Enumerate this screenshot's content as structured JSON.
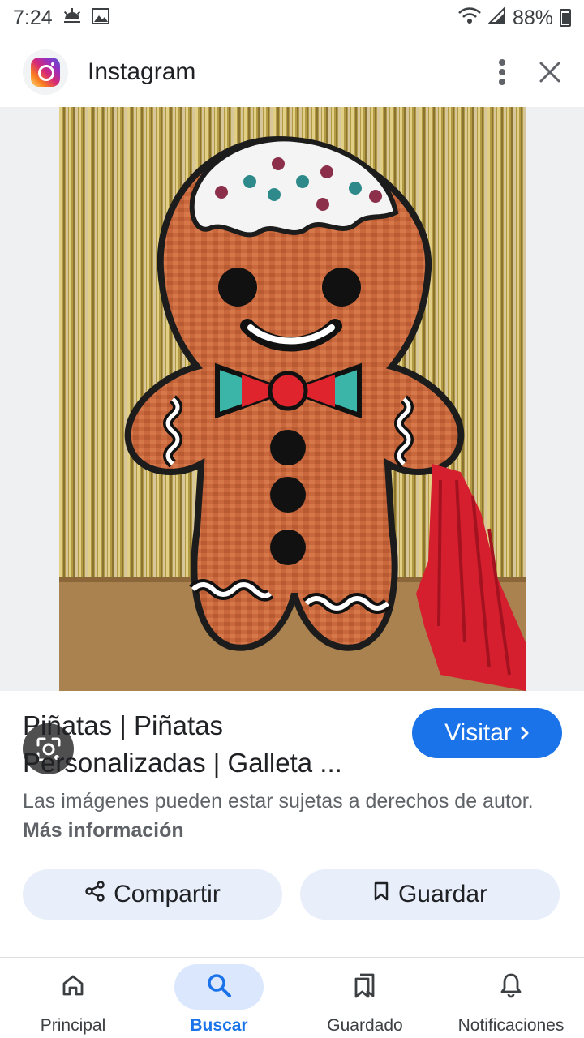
{
  "status_bar": {
    "time": "7:24",
    "battery": "88%",
    "icons": [
      "weather-icon",
      "image-notification-icon",
      "wifi-icon",
      "signal-icon",
      "battery-icon"
    ]
  },
  "header": {
    "app_name": "Instagram",
    "logo_icon": "instagram-icon",
    "menu_icon": "more-vert-icon",
    "close_icon": "close-icon"
  },
  "image": {
    "lens_icon": "google-lens-icon"
  },
  "result": {
    "title": "Piñatas | Piñatas Personalizadas | Galleta ...",
    "visit_label": "Visitar",
    "copyright_notice": "Las imágenes pueden estar sujetas a derechos de autor.",
    "more_info_label": "Más información"
  },
  "actions": {
    "share_label": "Compartir",
    "save_label": "Guardar"
  },
  "bottom_nav": {
    "items": [
      {
        "label": "Principal",
        "icon": "home-icon",
        "active": false
      },
      {
        "label": "Buscar",
        "icon": "search-icon",
        "active": true
      },
      {
        "label": "Guardado",
        "icon": "saved-icon",
        "active": false
      },
      {
        "label": "Notificaciones",
        "icon": "bell-icon",
        "active": false
      }
    ]
  },
  "colors": {
    "accent": "#1a73e8",
    "chip_bg": "#e8eefa",
    "nav_active_bg": "#dbe7fd"
  }
}
